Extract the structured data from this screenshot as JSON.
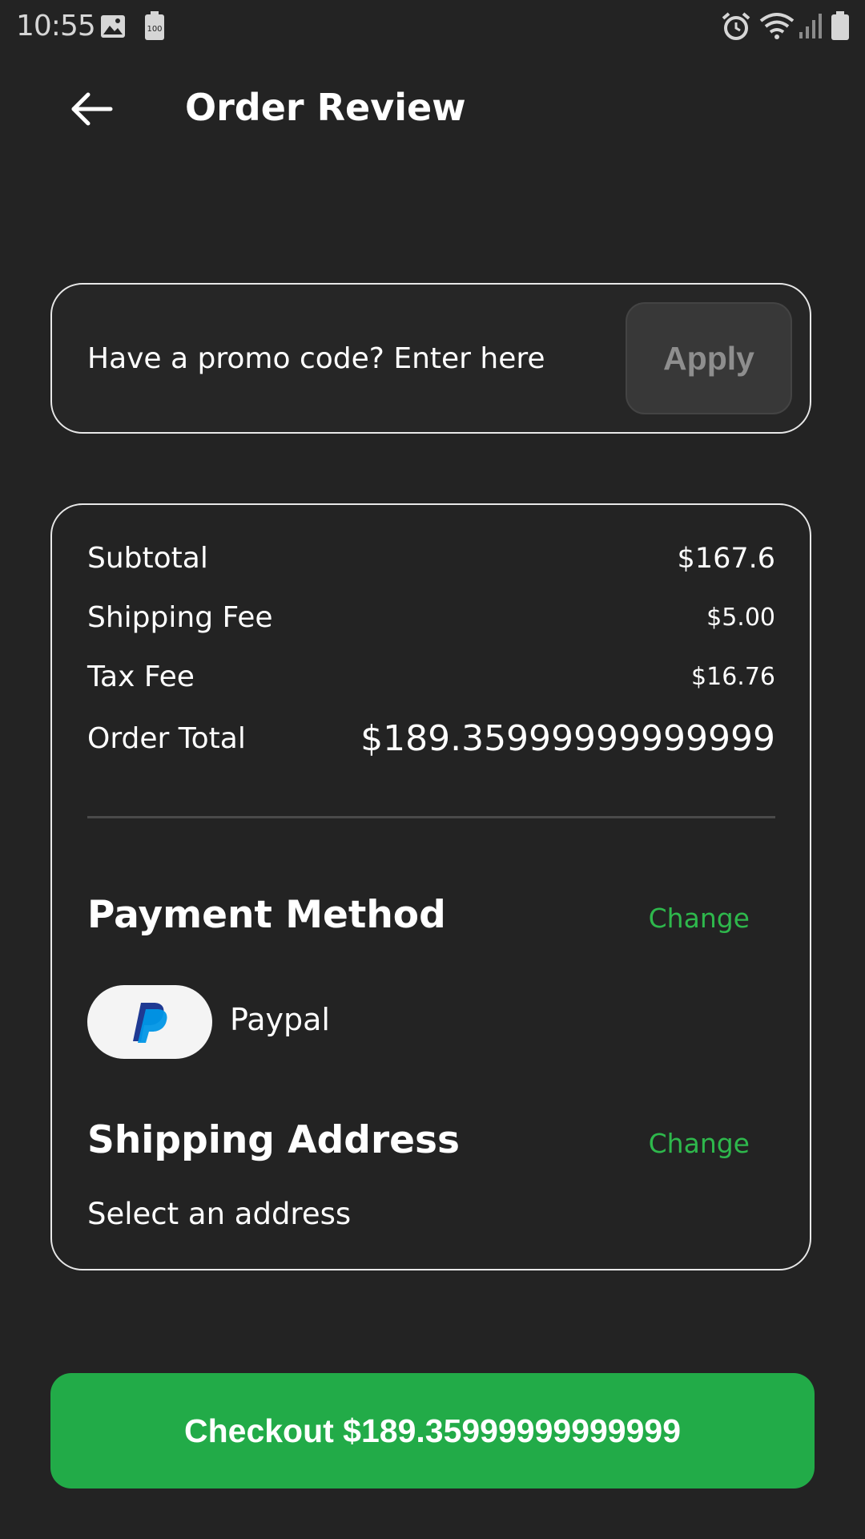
{
  "status_bar": {
    "time": "10:55",
    "battery_small_label": "100"
  },
  "header": {
    "title": "Order Review"
  },
  "promo": {
    "placeholder": "Have a promo code? Enter here",
    "apply_label": "Apply"
  },
  "summary": {
    "rows": [
      {
        "label": "Subtotal",
        "value": "$167.6"
      },
      {
        "label": "Shipping Fee",
        "value": "$5.00"
      },
      {
        "label": "Tax Fee",
        "value": "$16.76"
      },
      {
        "label": "Order Total",
        "value": "$189.35999999999999"
      }
    ]
  },
  "payment": {
    "title": "Payment Method",
    "change_label": "Change",
    "method_name": "Paypal",
    "method_icon": "paypal-logo-icon"
  },
  "shipping": {
    "title": "Shipping Address",
    "change_label": "Change",
    "address": "Select an address"
  },
  "checkout": {
    "label": "Checkout $189.35999999999999"
  },
  "colors": {
    "background": "#232323",
    "accent_green": "#22ab48",
    "link_green": "#2eb84c",
    "card_border": "#e8e8e8"
  }
}
